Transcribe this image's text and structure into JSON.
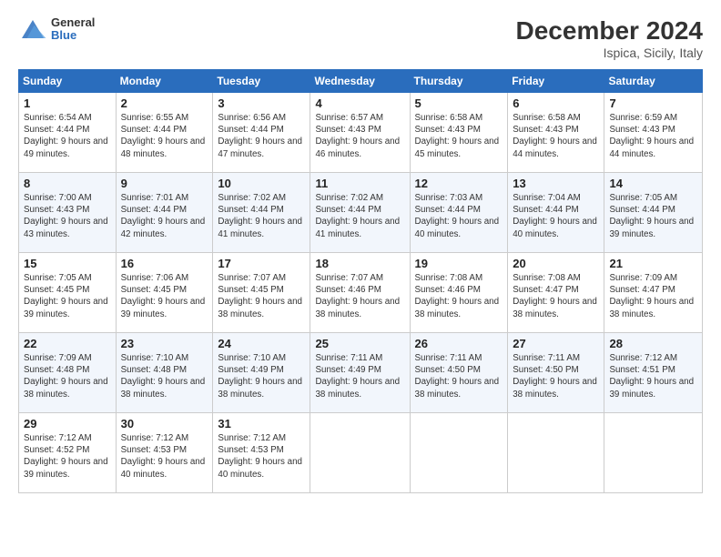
{
  "header": {
    "logo_general": "General",
    "logo_blue": "Blue",
    "title": "December 2024",
    "subtitle": "Ispica, Sicily, Italy"
  },
  "days_of_week": [
    "Sunday",
    "Monday",
    "Tuesday",
    "Wednesday",
    "Thursday",
    "Friday",
    "Saturday"
  ],
  "weeks": [
    [
      {
        "day": "1",
        "sunrise": "6:54 AM",
        "sunset": "4:44 PM",
        "daylight": "9 hours and 49 minutes."
      },
      {
        "day": "2",
        "sunrise": "6:55 AM",
        "sunset": "4:44 PM",
        "daylight": "9 hours and 48 minutes."
      },
      {
        "day": "3",
        "sunrise": "6:56 AM",
        "sunset": "4:44 PM",
        "daylight": "9 hours and 47 minutes."
      },
      {
        "day": "4",
        "sunrise": "6:57 AM",
        "sunset": "4:43 PM",
        "daylight": "9 hours and 46 minutes."
      },
      {
        "day": "5",
        "sunrise": "6:58 AM",
        "sunset": "4:43 PM",
        "daylight": "9 hours and 45 minutes."
      },
      {
        "day": "6",
        "sunrise": "6:58 AM",
        "sunset": "4:43 PM",
        "daylight": "9 hours and 44 minutes."
      },
      {
        "day": "7",
        "sunrise": "6:59 AM",
        "sunset": "4:43 PM",
        "daylight": "9 hours and 44 minutes."
      }
    ],
    [
      {
        "day": "8",
        "sunrise": "7:00 AM",
        "sunset": "4:43 PM",
        "daylight": "9 hours and 43 minutes."
      },
      {
        "day": "9",
        "sunrise": "7:01 AM",
        "sunset": "4:44 PM",
        "daylight": "9 hours and 42 minutes."
      },
      {
        "day": "10",
        "sunrise": "7:02 AM",
        "sunset": "4:44 PM",
        "daylight": "9 hours and 41 minutes."
      },
      {
        "day": "11",
        "sunrise": "7:02 AM",
        "sunset": "4:44 PM",
        "daylight": "9 hours and 41 minutes."
      },
      {
        "day": "12",
        "sunrise": "7:03 AM",
        "sunset": "4:44 PM",
        "daylight": "9 hours and 40 minutes."
      },
      {
        "day": "13",
        "sunrise": "7:04 AM",
        "sunset": "4:44 PM",
        "daylight": "9 hours and 40 minutes."
      },
      {
        "day": "14",
        "sunrise": "7:05 AM",
        "sunset": "4:44 PM",
        "daylight": "9 hours and 39 minutes."
      }
    ],
    [
      {
        "day": "15",
        "sunrise": "7:05 AM",
        "sunset": "4:45 PM",
        "daylight": "9 hours and 39 minutes."
      },
      {
        "day": "16",
        "sunrise": "7:06 AM",
        "sunset": "4:45 PM",
        "daylight": "9 hours and 39 minutes."
      },
      {
        "day": "17",
        "sunrise": "7:07 AM",
        "sunset": "4:45 PM",
        "daylight": "9 hours and 38 minutes."
      },
      {
        "day": "18",
        "sunrise": "7:07 AM",
        "sunset": "4:46 PM",
        "daylight": "9 hours and 38 minutes."
      },
      {
        "day": "19",
        "sunrise": "7:08 AM",
        "sunset": "4:46 PM",
        "daylight": "9 hours and 38 minutes."
      },
      {
        "day": "20",
        "sunrise": "7:08 AM",
        "sunset": "4:47 PM",
        "daylight": "9 hours and 38 minutes."
      },
      {
        "day": "21",
        "sunrise": "7:09 AM",
        "sunset": "4:47 PM",
        "daylight": "9 hours and 38 minutes."
      }
    ],
    [
      {
        "day": "22",
        "sunrise": "7:09 AM",
        "sunset": "4:48 PM",
        "daylight": "9 hours and 38 minutes."
      },
      {
        "day": "23",
        "sunrise": "7:10 AM",
        "sunset": "4:48 PM",
        "daylight": "9 hours and 38 minutes."
      },
      {
        "day": "24",
        "sunrise": "7:10 AM",
        "sunset": "4:49 PM",
        "daylight": "9 hours and 38 minutes."
      },
      {
        "day": "25",
        "sunrise": "7:11 AM",
        "sunset": "4:49 PM",
        "daylight": "9 hours and 38 minutes."
      },
      {
        "day": "26",
        "sunrise": "7:11 AM",
        "sunset": "4:50 PM",
        "daylight": "9 hours and 38 minutes."
      },
      {
        "day": "27",
        "sunrise": "7:11 AM",
        "sunset": "4:50 PM",
        "daylight": "9 hours and 38 minutes."
      },
      {
        "day": "28",
        "sunrise": "7:12 AM",
        "sunset": "4:51 PM",
        "daylight": "9 hours and 39 minutes."
      }
    ],
    [
      {
        "day": "29",
        "sunrise": "7:12 AM",
        "sunset": "4:52 PM",
        "daylight": "9 hours and 39 minutes."
      },
      {
        "day": "30",
        "sunrise": "7:12 AM",
        "sunset": "4:53 PM",
        "daylight": "9 hours and 40 minutes."
      },
      {
        "day": "31",
        "sunrise": "7:12 AM",
        "sunset": "4:53 PM",
        "daylight": "9 hours and 40 minutes."
      },
      null,
      null,
      null,
      null
    ]
  ]
}
